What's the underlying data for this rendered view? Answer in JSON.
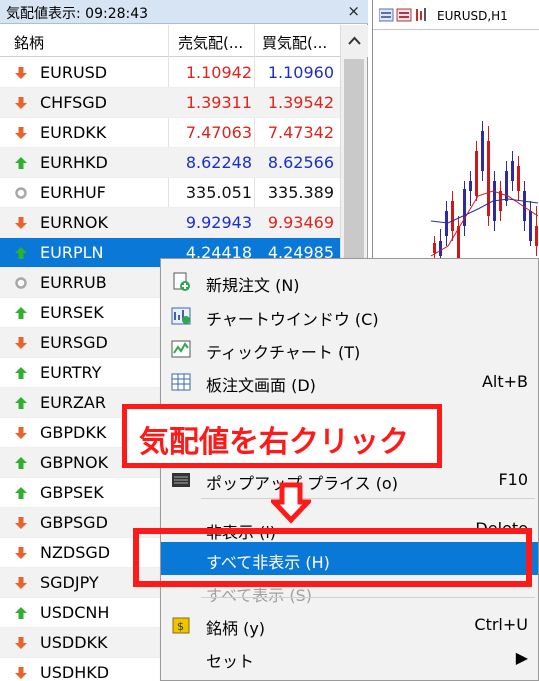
{
  "market_watch": {
    "title": "気配値表示: 09:28:43",
    "close": "×",
    "headers": {
      "symbol": "銘柄",
      "bid": "売気配(...",
      "ask": "買気配(..."
    },
    "rows": [
      {
        "symbol": "EURUSD",
        "bid": "1.10942",
        "ask": "1.10960",
        "trend": "down",
        "bid_color": "red",
        "ask_color": "blue"
      },
      {
        "symbol": "CHFSGD",
        "bid": "1.39311",
        "ask": "1.39542",
        "trend": "down",
        "bid_color": "red",
        "ask_color": "red"
      },
      {
        "symbol": "EURDKK",
        "bid": "7.47063",
        "ask": "7.47342",
        "trend": "down",
        "bid_color": "red",
        "ask_color": "red"
      },
      {
        "symbol": "EURHKD",
        "bid": "8.62248",
        "ask": "8.62566",
        "trend": "up",
        "bid_color": "blue",
        "ask_color": "blue"
      },
      {
        "symbol": "EURHUF",
        "bid": "335.051",
        "ask": "335.389",
        "trend": "neutral",
        "bid_color": "black",
        "ask_color": "black"
      },
      {
        "symbol": "EURNOK",
        "bid": "9.92943",
        "ask": "9.93469",
        "trend": "down",
        "bid_color": "blue",
        "ask_color": "red"
      },
      {
        "symbol": "EURPLN",
        "bid": "4.24418",
        "ask": "4.24985",
        "trend": "up",
        "bid_color": "white",
        "ask_color": "white",
        "selected": true
      },
      {
        "symbol": "EURRUB",
        "bid": "",
        "ask": "",
        "trend": "neutral"
      },
      {
        "symbol": "EURSEK",
        "bid": "",
        "ask": "",
        "trend": "up"
      },
      {
        "symbol": "EURSGD",
        "bid": "",
        "ask": "",
        "trend": "down"
      },
      {
        "symbol": "EURTRY",
        "bid": "",
        "ask": "",
        "trend": "up"
      },
      {
        "symbol": "EURZAR",
        "bid": "",
        "ask": "",
        "trend": "up"
      },
      {
        "symbol": "GBPDKK",
        "bid": "",
        "ask": "",
        "trend": "down"
      },
      {
        "symbol": "GBPNOK",
        "bid": "",
        "ask": "",
        "trend": "up"
      },
      {
        "symbol": "GBPSEK",
        "bid": "",
        "ask": "",
        "trend": "up"
      },
      {
        "symbol": "GBPSGD",
        "bid": "",
        "ask": "",
        "trend": "down"
      },
      {
        "symbol": "NZDSGD",
        "bid": "",
        "ask": "",
        "trend": "down"
      },
      {
        "symbol": "SGDJPY",
        "bid": "",
        "ask": "",
        "trend": "down"
      },
      {
        "symbol": "USDCNH",
        "bid": "",
        "ask": "",
        "trend": "up"
      },
      {
        "symbol": "USDDKK",
        "bid": "",
        "ask": "",
        "trend": "down"
      },
      {
        "symbol": "USDHKD",
        "bid": "",
        "ask": "",
        "trend": "down"
      }
    ]
  },
  "chart": {
    "symbol": "EURUSD,H1"
  },
  "context_menu": {
    "items": [
      {
        "label": "新規注文 (N)",
        "shortcut": "",
        "icon": "new-order-icon",
        "state": "normal"
      },
      {
        "label": "チャートウインドウ (C)",
        "shortcut": "",
        "icon": "chart-window-icon",
        "state": "normal"
      },
      {
        "label": "ティックチャート (T)",
        "shortcut": "",
        "icon": "tick-chart-icon",
        "state": "normal"
      },
      {
        "label": "板注文画面 (D)",
        "shortcut": "Alt+B",
        "icon": "depth-of-market-icon",
        "state": "normal"
      },
      {
        "label": "ポップアップ プライス (o)",
        "shortcut": "F10",
        "icon": "popup-prices-icon",
        "state": "normal"
      },
      {
        "label": "非表示 (i)",
        "shortcut": "Delete",
        "icon": "",
        "state": "normal"
      },
      {
        "label": "すべて非表示 (H)",
        "shortcut": "",
        "icon": "",
        "state": "highlighted"
      },
      {
        "label": "すべて表示 (S)",
        "shortcut": "",
        "icon": "",
        "state": "disabled"
      },
      {
        "label": "銘柄 (y)",
        "shortcut": "Ctrl+U",
        "icon": "symbols-icon",
        "state": "normal"
      },
      {
        "label": "セット",
        "shortcut": "▶",
        "icon": "",
        "state": "normal"
      }
    ]
  },
  "annotation": {
    "callout": "気配値を右クリック"
  },
  "colors": {
    "up": "#2fb12f",
    "down": "#e8642c",
    "neutral": "#a8a8a8",
    "selection": "#0a78d7",
    "annotation": "#ff1a1a"
  }
}
